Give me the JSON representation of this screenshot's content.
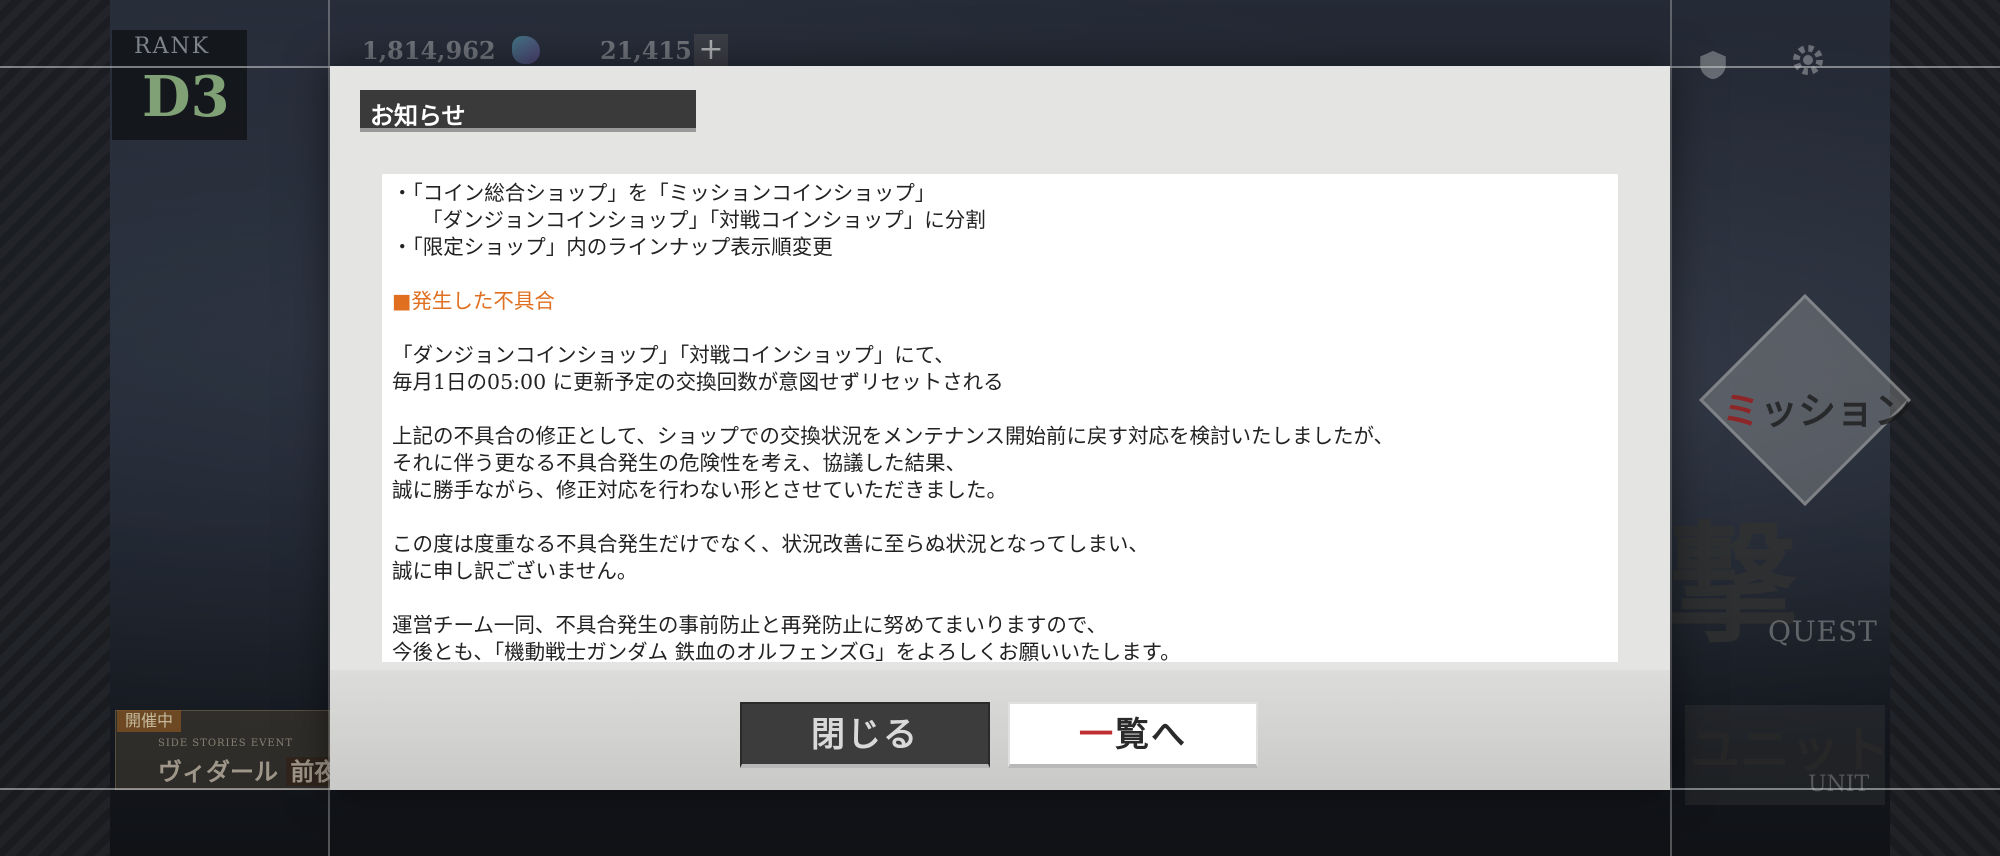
{
  "hud": {
    "rank_label": "RANK",
    "rank_value": "D3",
    "currency_1": "1,814,962",
    "currency_2": "21,415",
    "plus_label": "+"
  },
  "right_menu": {
    "mission_label_first": "ミ",
    "mission_label_rest": "ッション",
    "big_kanji": "撃",
    "quest_label": "QUEST",
    "unit_label": "ユニット",
    "unit_sub": "UNIT"
  },
  "event_banner": {
    "tag": "開催中",
    "small_text": "SIDE STORIES EVENT",
    "title_a": "ヴィダール",
    "title_b": "前夜"
  },
  "dialog": {
    "title": "お知らせ",
    "lines": [
      {
        "text": "・「コイン総合ショップ」を「ミッションコインショップ」",
        "style": "normal"
      },
      {
        "text": "「ダンジョンコインショップ」「対戦コインショップ」に分割",
        "style": "indent"
      },
      {
        "text": "・「限定ショップ」内のラインナップ表示順変更",
        "style": "normal"
      },
      {
        "text": "",
        "style": "blank"
      },
      {
        "text": "■発生した不具合",
        "style": "heading"
      },
      {
        "text": "",
        "style": "blank"
      },
      {
        "text": "「ダンジョンコインショップ」「対戦コインショップ」にて、",
        "style": "normal"
      },
      {
        "text": "毎月1日の05:00 に更新予定の交換回数が意図せずリセットされる",
        "style": "normal"
      },
      {
        "text": "",
        "style": "blank"
      },
      {
        "text": "上記の不具合の修正として、ショップでの交換状況をメンテナンス開始前に戻す対応を検討いたしましたが、",
        "style": "normal"
      },
      {
        "text": "それに伴う更なる不具合発生の危険性を考え、協議した結果、",
        "style": "normal"
      },
      {
        "text": "誠に勝手ながら、修正対応を行わない形とさせていただきました。",
        "style": "normal"
      },
      {
        "text": "",
        "style": "blank"
      },
      {
        "text": "この度は度重なる不具合発生だけでなく、状況改善に至らぬ状況となってしまい、",
        "style": "normal"
      },
      {
        "text": "誠に申し訳ございません。",
        "style": "normal"
      },
      {
        "text": "",
        "style": "blank"
      },
      {
        "text": "運営チーム一同、不具合発生の事前防止と再発防止に努めてまいりますので、",
        "style": "normal"
      },
      {
        "text": "今後とも、「機動戦士ガンダム 鉄血のオルフェンズG」をよろしくお願いいたします。",
        "style": "normal"
      }
    ],
    "close_label": "閉じる",
    "list_label_first": "一",
    "list_label_rest": "覧へ"
  },
  "colors": {
    "heading": "#e07020",
    "dialog_bg": "#e4e4e2",
    "title_bar": "#3a3a3a",
    "close_btn": "#3c3c3c",
    "list_accent": "#c03030"
  }
}
